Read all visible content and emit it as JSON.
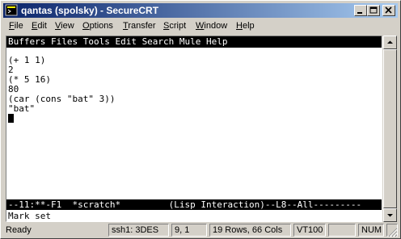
{
  "window": {
    "title": "qantas (spolsky) - SecureCRT",
    "icon": "terminal-icon"
  },
  "menubar": {
    "items": [
      {
        "label": "File",
        "accel": "F",
        "rest": "ile"
      },
      {
        "label": "Edit",
        "accel": "E",
        "rest": "dit"
      },
      {
        "label": "View",
        "accel": "V",
        "rest": "iew"
      },
      {
        "label": "Options",
        "accel": "O",
        "rest": "ptions"
      },
      {
        "label": "Transfer",
        "accel": "T",
        "rest": "ransfer"
      },
      {
        "label": "Script",
        "accel": "S",
        "rest": "cript"
      },
      {
        "label": "Window",
        "accel": "W",
        "rest": "indow"
      },
      {
        "label": "Help",
        "accel": "H",
        "rest": "elp"
      }
    ]
  },
  "emacs": {
    "menu": "Buffers Files Tools Edit Search Mule Help",
    "lines": [
      "(+ 1 1)",
      "2",
      "(* 5 16)",
      "80",
      "(car (cons \"bat\" 3))",
      "\"bat\""
    ],
    "modeline": "--11:**-F1  *scratch*         (Lisp Interaction)--L8--All---------",
    "minibuffer": "Mark set"
  },
  "status": {
    "ready": "Ready",
    "cipher": "ssh1: 3DES",
    "position": "9,  1",
    "size": "19 Rows, 66 Cols",
    "emulation": "VT100",
    "num": "NUM"
  },
  "colors": {
    "title_start": "#0a246a",
    "title_end": "#a6caf0",
    "chrome": "#d4d0c8"
  }
}
